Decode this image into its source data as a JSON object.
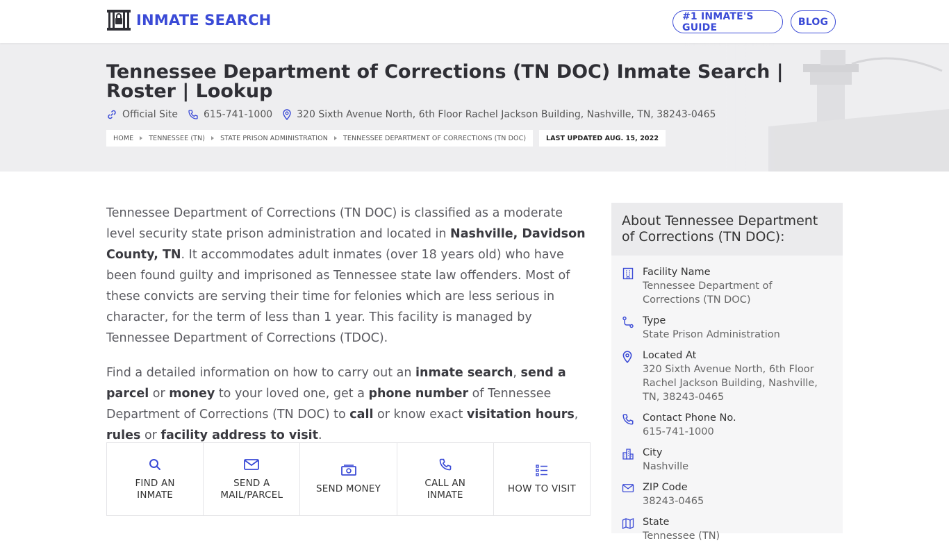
{
  "header": {
    "logo_text": "INMATE SEARCH",
    "nav": [
      {
        "label": "#1 INMATE'S GUIDE"
      },
      {
        "label": "BLOG"
      }
    ]
  },
  "hero": {
    "title": "Tennessee Department of Corrections (TN DOC) Inmate Search | Roster | Lookup",
    "official_site": "Official Site",
    "phone": "615-741-1000",
    "address": "320 Sixth Avenue North, 6th Floor Rachel Jackson Building, Nashville, TN, 38243-0465",
    "breadcrumbs": [
      "HOME",
      "TENNESSEE (TN)",
      "STATE PRISON ADMINISTRATION",
      "TENNESSEE DEPARTMENT OF CORRECTIONS (TN DOC)"
    ],
    "last_updated": "LAST UPDATED AUG. 15, 2022"
  },
  "content": {
    "p1": {
      "a": "Tennessee Department of Corrections (TN DOC) is classified as a moderate level security state prison administration and located in ",
      "b": "Nashville, Davidson County, TN",
      "c": ". It accommodates adult inmates (over 18 years old) who have been found guilty and imprisoned as Tennessee state law offenders. Most of these convicts are serving their time for felonies which are less serious in character, for the term of less than 1 year. This facility is managed by Tennessee Department of Corrections (TDOC)."
    },
    "p2": {
      "t1": "Find a detailed information on how to carry out an ",
      "b1": "inmate search",
      "t2": ", ",
      "b2": "send a parcel",
      "t3": " or ",
      "b3": "money",
      "t4": " to your loved one, get a ",
      "b4": "phone number",
      "t5": " of Tennessee Department of Corrections (TN DOC) to ",
      "b5": "call",
      "t6": " or know exact ",
      "b6": "visitation hours",
      "t7": ", ",
      "b7": "rules",
      "t8": " or ",
      "b8": "facility address to visit",
      "t9": "."
    },
    "actions": [
      {
        "line1": "FIND AN",
        "line2": "INMATE",
        "icon": "search-icon"
      },
      {
        "line1": "SEND A",
        "line2": "MAIL/PARCEL",
        "icon": "mail-icon"
      },
      {
        "line1": "SEND MONEY",
        "line2": "",
        "icon": "money-icon"
      },
      {
        "line1": "CALL AN",
        "line2": "INMATE",
        "icon": "phone-icon"
      },
      {
        "line1": "HOW TO VISIT",
        "line2": "",
        "icon": "list-icon"
      }
    ]
  },
  "sidebar": {
    "title": "About Tennessee Department of Corrections (TN DOC):",
    "rows": [
      {
        "label": "Facility Name",
        "value": "Tennessee Department of Corrections (TN DOC)",
        "icon": "building-icon"
      },
      {
        "label": "Type",
        "value": "State Prison Administration",
        "icon": "route-icon"
      },
      {
        "label": "Located At",
        "value": "320 Sixth Avenue North, 6th Floor Rachel Jackson Building, Nashville, TN, 38243-0465",
        "icon": "map-pin-icon"
      },
      {
        "label": "Contact Phone No.",
        "value": "615-741-1000",
        "icon": "phone-icon"
      },
      {
        "label": "City",
        "value": "Nashville",
        "icon": "city-icon"
      },
      {
        "label": "ZIP Code",
        "value": "38243-0465",
        "icon": "mail-icon"
      },
      {
        "label": "State",
        "value": "Tennessee (TN)",
        "icon": "map-icon"
      }
    ]
  },
  "colors": {
    "accent": "#3a4ad6",
    "hero_bg": "#eeeef0",
    "sidebar_bg": "#f6f6f7"
  }
}
